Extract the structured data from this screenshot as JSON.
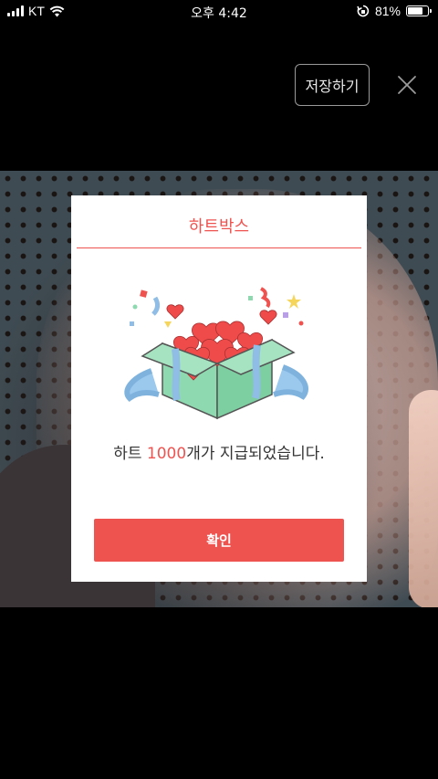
{
  "status_bar": {
    "carrier": "KT",
    "time": "오후 4:42",
    "battery_percent_label": "81%",
    "battery_level": 0.81
  },
  "toolbar": {
    "save_label": "저장하기"
  },
  "dialog": {
    "title": "하트박스",
    "message_prefix": "하트 ",
    "message_amount": "1000",
    "message_suffix": "개가 지급되었습니다.",
    "confirm_label": "확인"
  },
  "colors": {
    "accent": "#ef5350",
    "gift_box": "#8fd9b0",
    "ribbon": "#8fbde6",
    "hearts": "#ef4b4b"
  }
}
